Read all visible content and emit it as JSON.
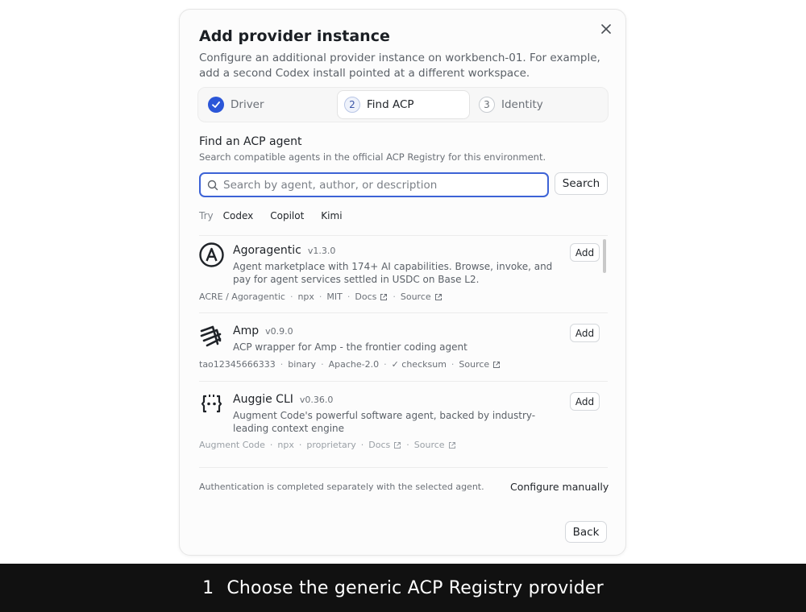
{
  "dialog": {
    "title": "Add provider instance",
    "subtitle": "Configure an additional provider instance on workbench-01. For example, add a second Codex install pointed at a different workspace.",
    "close_icon": "close-icon"
  },
  "stepper": {
    "steps": [
      {
        "number": "1",
        "label": "Driver",
        "state": "completed"
      },
      {
        "number": "2",
        "label": "Find ACP",
        "state": "active"
      },
      {
        "number": "3",
        "label": "Identity",
        "state": "upcoming"
      }
    ],
    "accent": "#2b56d8"
  },
  "find": {
    "title": "Find an ACP agent",
    "description": "Search compatible agents in the official ACP Registry for this environment.",
    "search_placeholder": "Search by agent, author, or description",
    "search_value": "",
    "search_button": "Search",
    "try_label": "Try",
    "suggestions": [
      "Codex",
      "Copilot",
      "Kimi"
    ]
  },
  "agents": [
    {
      "name": "Agoragentic",
      "version": "v1.3.0",
      "description": "Agent marketplace with 174+ AI capabilities. Browse, invoke, and pay for agent services settled in USDC on Base L2.",
      "logo": "circle-a-icon",
      "author": "ACRE / Agoragentic",
      "distribution": "npx",
      "license": "MIT",
      "docs": "Docs",
      "source": "Source",
      "add_label": "Add"
    },
    {
      "name": "Amp",
      "version": "v0.9.0",
      "description": "ACP wrapper for Amp - the frontier coding agent",
      "logo": "amp-lines-icon",
      "author": "tao12345666333",
      "distribution": "binary",
      "license": "Apache-2.0",
      "checksum": "✓ checksum",
      "source": "Source",
      "add_label": "Add"
    },
    {
      "name": "Auggie CLI",
      "version": "v0.36.0",
      "description": "Augment Code's powerful software agent, backed by industry-leading context engine",
      "logo": "bracket-face-icon",
      "author": "Augment Code",
      "distribution": "npx",
      "license": "proprietary",
      "docs": "Docs",
      "source": "Source",
      "add_label": "Add"
    }
  ],
  "footer": {
    "note": "Authentication is completed separately with the selected agent.",
    "configure_manually": "Configure manually",
    "back": "Back"
  },
  "caption": {
    "number": "1",
    "text": "Choose the generic ACP Registry provider"
  }
}
